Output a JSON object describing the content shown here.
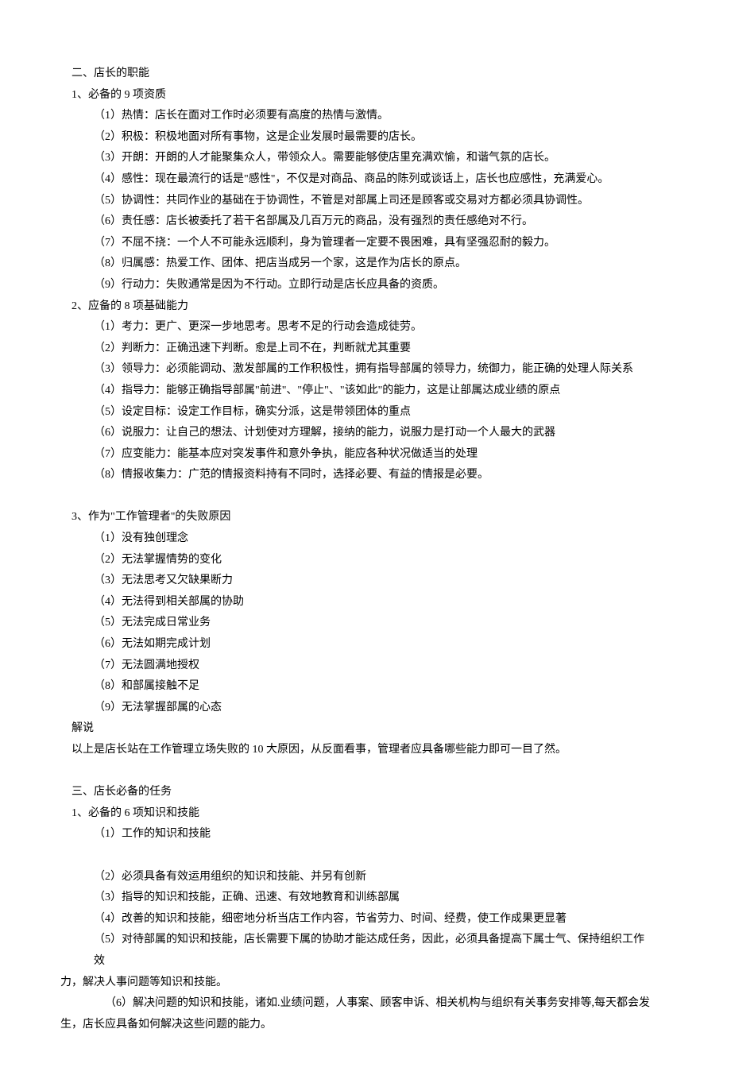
{
  "s2": {
    "title": "二、店长的职能",
    "p1": {
      "title": "1、必备的 9 项资质",
      "items": [
        "（1）热情：店长在面对工作时必须要有高度的热情与激情。",
        "（2）积极：积极地面对所有事物，这是企业发展时最需要的店长。",
        "（3）开朗：开朗的人才能聚集众人，带领众人。需要能够使店里充满欢愉，和谐气氛的店长。",
        "（4）感性：现在最流行的话是\"感性\"，不仅是对商品、商品的陈列或谈话上，店长也应感性，充满爱心。",
        "（5）协调性：共同作业的基础在于协调性，不管是对部属上司还是顾客或交易对方都必须具协调性。",
        "（6）责任感：店长被委托了若干名部属及几百万元的商品，没有强烈的责任感绝对不行。",
        "（7）不屈不挠：一个人不可能永远顺利，身为管理者一定要不畏困难，具有坚强忍耐的毅力。",
        "（8）归属感：热爱工作、团体、把店当成另一个家，这是作为店长的原点。",
        "（9）行动力：失败通常是因为不行动。立即行动是店长应具备的资质。"
      ]
    },
    "p2": {
      "title": "2、应备的 8 项基础能力",
      "items": [
        "（1）考力：更广、更深一步地思考。思考不足的行动会造成徒劳。",
        "（2）判断力：正确迅速下判断。愈是上司不在，判断就尤其重要",
        "（3）领导力：必须能调动、激发部属的工作积极性，拥有指导部属的领导力，统御力，能正确的处理人际关系",
        "（4）指导力：能够正确指导部属\"前进\"、\"停止\"、\"该如此\"的能力，这是让部属达成业绩的原点",
        "（5）设定目标：设定工作目标，确实分派，这是带领团体的重点",
        "（6）说服力：让自己的想法、计划使对方理解，接纳的能力，说服力是打动一个人最大的武器",
        "（7）应变能力：能基本应对突发事件和意外争执，能应各种状况做适当的处理",
        "（8）情报收集力：广范的情报资料持有不同时，选择必要、有益的情报是必要。"
      ]
    },
    "p3": {
      "title": "3、作为\"工作管理者\"的失败原因",
      "items": [
        "（1）没有独创理念",
        "（2）无法掌握情势的变化",
        "（3）无法思考又欠缺果断力",
        "（4）无法得到相关部属的协助",
        "（5）无法完成日常业务",
        "（6）无法如期完成计划",
        "（7）无法圆满地授权",
        "（8）和部属接触不足",
        "（9）无法掌握部属的心态"
      ],
      "explain_label": "解说",
      "explain_text": "以上是店长站在工作管理立场失败的 10 大原因，从反面看事，管理者应具备哪些能力即可一目了然。"
    }
  },
  "s3": {
    "title": "三、店长必备的任务",
    "p1": {
      "title": "1、必备的 6 项知识和技能",
      "items": [
        "（1）工作的知识和技能",
        "（2）必须具备有效运用组织的知识和技能、并另有创新",
        "（3）指导的知识和技能，正确、迅速、有效地教育和训练部属",
        "（4）改善的知识和技能，细密地分析当店工作内容，节省劳力、时间、经费，使工作成果更显著"
      ],
      "item5_indent": "（5）对待部属的知识和技能，店长需要下属的协助才能达成任务，因此，必须具备提高下属士气、保持组织工作效",
      "item5_cont": "力，解决人事问题等知识和技能。",
      "item6_indent": "（6）解决问题的知识和技能，诸如.业绩问题，人事案、顾客申诉、相关机构与组织有关事务安排等,每天都会发",
      "item6_cont": "生，店长应具备如何解决这些问题的能力。"
    }
  }
}
